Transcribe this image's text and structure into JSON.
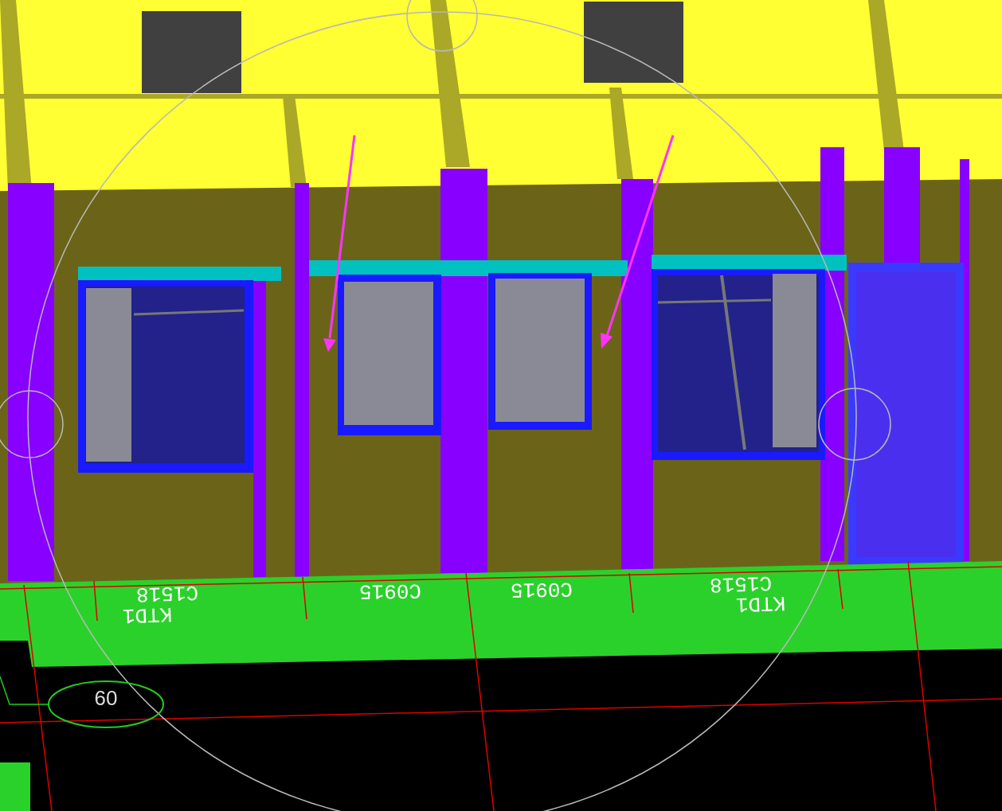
{
  "viewport": {
    "labels": [
      {
        "text": "C1518",
        "kind": "rotated"
      },
      {
        "text": "KTD1",
        "kind": "rotated"
      },
      {
        "text": "C0915",
        "kind": "rotated"
      },
      {
        "text": "C0915",
        "kind": "rotated"
      },
      {
        "text": "C1518",
        "kind": "rotated"
      },
      {
        "text": "KTD1",
        "kind": "rotated"
      }
    ],
    "axis_bubble": {
      "text": "09"
    }
  }
}
